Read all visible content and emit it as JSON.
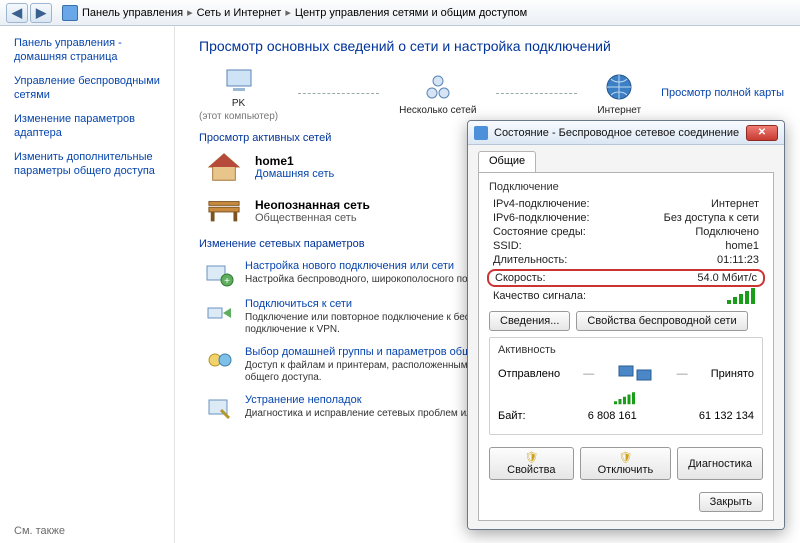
{
  "breadcrumb": {
    "items": [
      "Панель управления",
      "Сеть и Интернет",
      "Центр управления сетями и общим доступом"
    ]
  },
  "sidebar": {
    "home": "Панель управления - домашняя страница",
    "links": [
      "Управление беспроводными сетями",
      "Изменение параметров адаптера",
      "Изменить дополнительные параметры общего доступа"
    ],
    "see_also": "См. также"
  },
  "main": {
    "heading": "Просмотр основных сведений о сети и настройка подключений",
    "map_link": "Просмотр полной карты",
    "nodes": {
      "pc_name": "PK",
      "pc_sub": "(этот компьютер)",
      "multi": "Несколько сетей",
      "internet": "Интернет"
    },
    "active_label": "Просмотр активных сетей",
    "nets": [
      {
        "name": "home1",
        "sub_link": "Домашняя сеть"
      },
      {
        "name": "Неопознанная сеть",
        "sub_text": "Общественная сеть"
      }
    ],
    "params_label": "Изменение сетевых параметров",
    "tasks": [
      {
        "title": "Настройка нового подключения или сети",
        "desc": "Настройка беспроводного, широкополосного подключения; или же настройка маршрутизатора или точки доступа."
      },
      {
        "title": "Подключиться к сети",
        "desc": "Подключение или повторное подключение к беспроводному, проводному, модемному сетевому соединению или подключение к VPN."
      },
      {
        "title": "Выбор домашней группы и параметров общего доступа",
        "desc": "Доступ к файлам и принтерам, расположенным на других сетевых компьютерах, или изменение параметров общего доступа."
      },
      {
        "title": "Устранение неполадок",
        "desc": "Диагностика и исправление сетевых проблем или получение сведений об исправлении."
      }
    ]
  },
  "dialog": {
    "title": "Состояние - Беспроводное сетевое соединение",
    "tab": "Общие",
    "group_conn": "Подключение",
    "rows": {
      "ipv4_l": "IPv4-подключение:",
      "ipv4_v": "Интернет",
      "ipv6_l": "IPv6-подключение:",
      "ipv6_v": "Без доступа к сети",
      "media_l": "Состояние среды:",
      "media_v": "Подключено",
      "ssid_l": "SSID:",
      "ssid_v": "home1",
      "dur_l": "Длительность:",
      "dur_v": "01:11:23",
      "speed_l": "Скорость:",
      "speed_v": "54.0 Мбит/с",
      "signal_l": "Качество сигнала:"
    },
    "btn_details": "Сведения...",
    "btn_wprops": "Свойства беспроводной сети",
    "group_act": "Активность",
    "act_sent": "Отправлено",
    "act_recv": "Принято",
    "act_bytes_l": "Байт:",
    "act_bytes_sent": "6 808 161",
    "act_bytes_recv": "61 132 134",
    "btn_props": "Свойства",
    "btn_disable": "Отключить",
    "btn_diag": "Диагностика",
    "btn_close": "Закрыть"
  }
}
